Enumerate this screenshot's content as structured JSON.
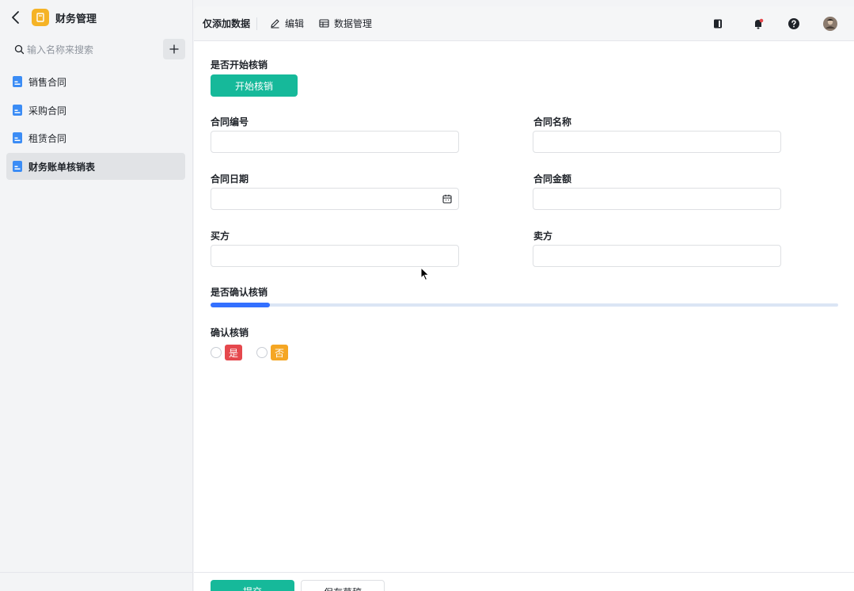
{
  "app": {
    "title": "财务管理"
  },
  "search": {
    "placeholder": "输入名称来搜索",
    "value": ""
  },
  "sidebar": {
    "items": [
      {
        "label": "销售合同",
        "active": false
      },
      {
        "label": "采购合同",
        "active": false
      },
      {
        "label": "租赁合同",
        "active": false
      },
      {
        "label": "财务账单核销表",
        "active": true
      }
    ]
  },
  "toolbar": {
    "title": "仅添加数据",
    "edit_label": "编辑",
    "data_label": "数据管理"
  },
  "form": {
    "start_label": "是否开始核销",
    "start_button": "开始核销",
    "contract_no_label": "合同编号",
    "contract_no_value": "",
    "contract_name_label": "合同名称",
    "contract_name_value": "",
    "contract_date_label": "合同日期",
    "contract_date_value": "",
    "contract_amount_label": "合同金额",
    "contract_amount_value": "",
    "buyer_label": "买方",
    "buyer_value": "",
    "seller_label": "卖方",
    "seller_value": "",
    "confirm_progress_label": "是否确认核销",
    "confirm_progress_value": 0.094,
    "confirm_label": "确认核销",
    "options": [
      {
        "label": "是",
        "color": "#e5484d"
      },
      {
        "label": "否",
        "color": "#f5a623"
      }
    ]
  },
  "footer": {
    "submit_label": "提交",
    "draft_label": "保存草稿"
  },
  "colors": {
    "accent": "#16b99a",
    "brand": "#3370ff",
    "logo": "#f5b326"
  }
}
